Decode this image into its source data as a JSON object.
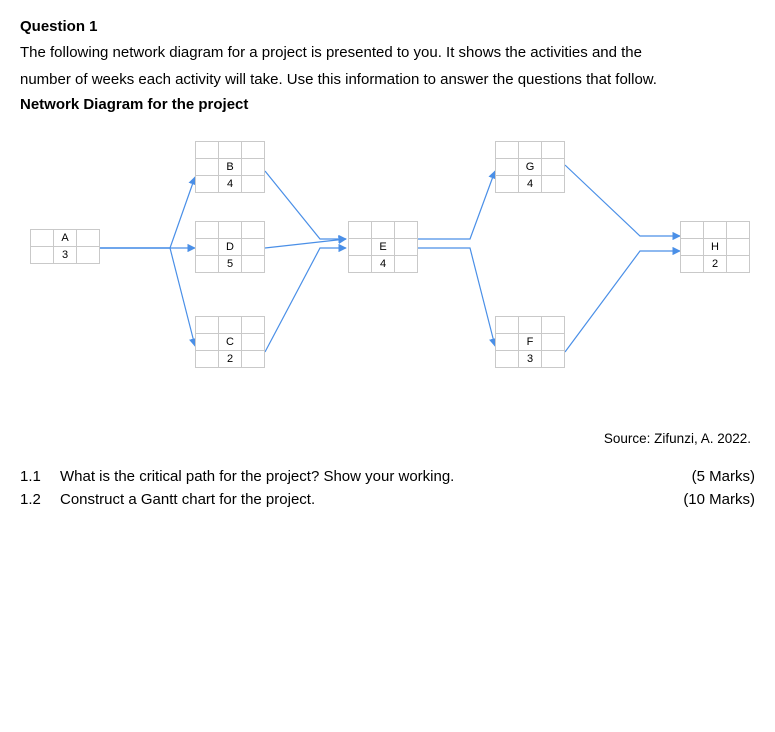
{
  "question_title": "Question 1",
  "intro_line1": "The following network diagram for a project is presented to you. It shows the activities and the",
  "intro_line2": "number of weeks each activity will take. Use this information to answer the questions that follow.",
  "diagram_title": "Network Diagram for the project",
  "nodes": {
    "A": {
      "label": "A",
      "value": "3"
    },
    "B": {
      "label": "B",
      "value": "4"
    },
    "C": {
      "label": "C",
      "value": "2"
    },
    "D": {
      "label": "D",
      "value": "5"
    },
    "E": {
      "label": "E",
      "value": "4"
    },
    "F": {
      "label": "F",
      "value": "3"
    },
    "G": {
      "label": "G",
      "value": "4"
    },
    "H": {
      "label": "H",
      "value": "2"
    }
  },
  "source": "Source: Zifunzi, A. 2022.",
  "subquestions": [
    {
      "num": "1.1",
      "text": "What is the critical path for the project? Show your working.",
      "marks": "(5 Marks)"
    },
    {
      "num": "1.2",
      "text": "Construct a Gantt chart for the project.",
      "marks": "(10 Marks)"
    }
  ],
  "chart_data": {
    "type": "table",
    "title": "Network Diagram for the project",
    "nodes": [
      {
        "activity": "A",
        "duration_weeks": 3
      },
      {
        "activity": "B",
        "duration_weeks": 4
      },
      {
        "activity": "C",
        "duration_weeks": 2
      },
      {
        "activity": "D",
        "duration_weeks": 5
      },
      {
        "activity": "E",
        "duration_weeks": 4
      },
      {
        "activity": "F",
        "duration_weeks": 3
      },
      {
        "activity": "G",
        "duration_weeks": 4
      },
      {
        "activity": "H",
        "duration_weeks": 2
      }
    ],
    "edges": [
      [
        "A",
        "B"
      ],
      [
        "A",
        "D"
      ],
      [
        "A",
        "C"
      ],
      [
        "B",
        "E"
      ],
      [
        "D",
        "E"
      ],
      [
        "C",
        "E"
      ],
      [
        "E",
        "G"
      ],
      [
        "E",
        "F"
      ],
      [
        "G",
        "H"
      ],
      [
        "F",
        "H"
      ]
    ]
  }
}
